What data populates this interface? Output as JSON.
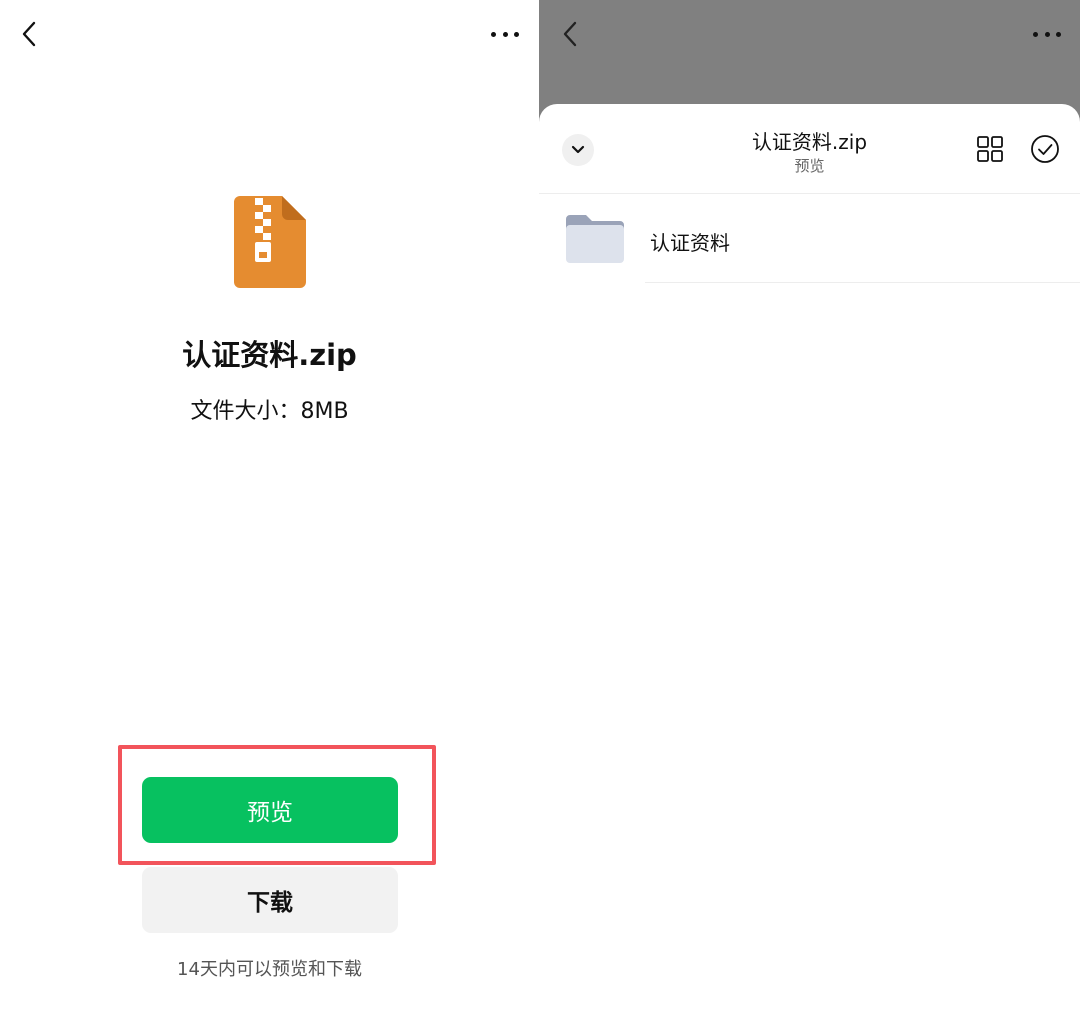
{
  "left_screen": {
    "file_name": "认证资料.zip",
    "file_size_label": "文件大小：",
    "file_size_value": "8MB",
    "preview_button": "预览",
    "download_button": "下载",
    "note": "14天内可以预览和下载",
    "icons": {
      "back": "chevron-left-icon",
      "more": "more-dots-icon",
      "file": "zip-file-icon"
    },
    "colors": {
      "preview_button_bg": "#07c160",
      "download_button_bg": "#f2f2f2",
      "highlight_border": "#f2545b",
      "zip_icon": "#e58c30"
    }
  },
  "right_screen": {
    "sheet_title": "认证资料.zip",
    "sheet_subtitle": "预览",
    "items": [
      {
        "label": "认证资料",
        "type": "folder"
      }
    ],
    "icons": {
      "back": "chevron-left-icon",
      "more": "more-dots-icon",
      "collapse": "chevron-down-icon",
      "grid": "grid-view-icon",
      "select": "check-circle-icon",
      "folder": "folder-icon"
    },
    "colors": {
      "overlay": "#808080",
      "folder": "#dde2ec"
    }
  }
}
